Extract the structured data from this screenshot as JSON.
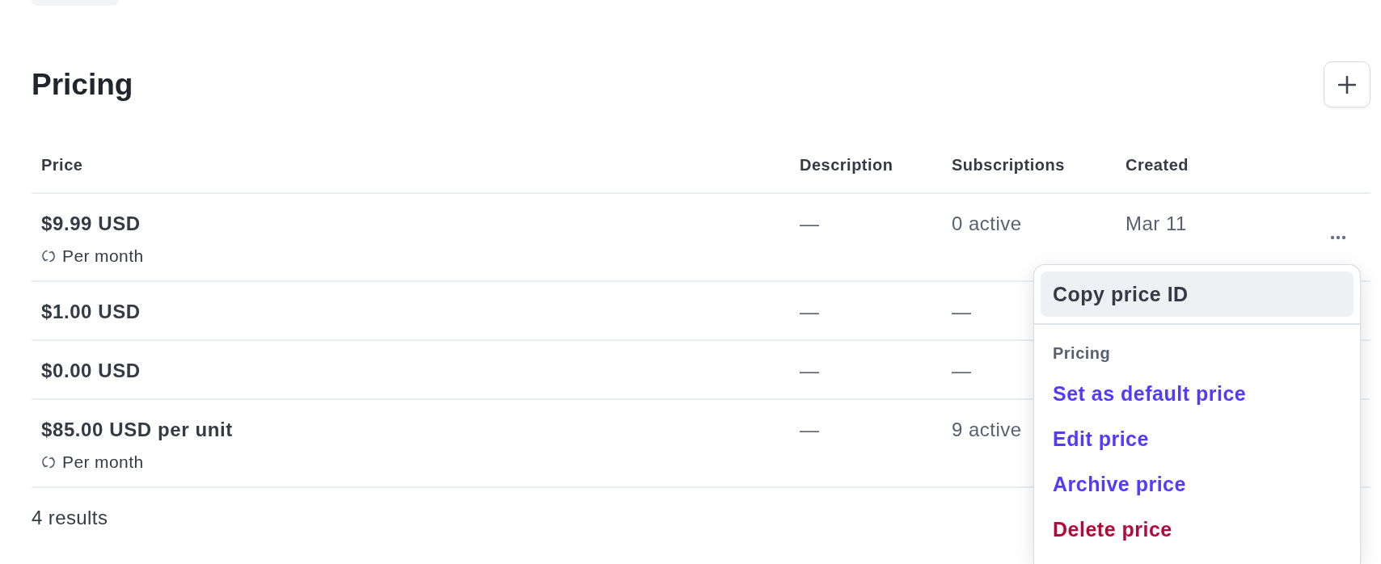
{
  "section": {
    "title": "Pricing"
  },
  "table": {
    "columns": [
      "Price",
      "Description",
      "Subscriptions",
      "Created"
    ],
    "rows": [
      {
        "price": "$9.99 USD",
        "interval": "Per month",
        "description": "—",
        "subscriptions": "0 active",
        "created": "Mar 11",
        "actions_visible": true
      },
      {
        "price": "$1.00 USD",
        "description": "—",
        "subscriptions": "—"
      },
      {
        "price": "$0.00 USD",
        "description": "—",
        "subscriptions": "—"
      },
      {
        "price": "$85.00 USD per unit",
        "interval": "Per month",
        "description": "—",
        "subscriptions": "9 active"
      }
    ]
  },
  "results_count": "4 results",
  "menu": {
    "sections": [
      {
        "items": [
          {
            "label": "Copy price ID",
            "kind": "neutral",
            "selected": true
          }
        ]
      },
      {
        "heading": "Pricing",
        "items": [
          {
            "label": "Set as default price",
            "kind": "primary",
            "selected": false
          },
          {
            "label": "Edit price",
            "kind": "primary",
            "selected": false
          },
          {
            "label": "Archive price",
            "kind": "primary",
            "selected": false
          },
          {
            "label": "Delete price",
            "kind": "danger",
            "selected": false
          }
        ]
      }
    ]
  }
}
